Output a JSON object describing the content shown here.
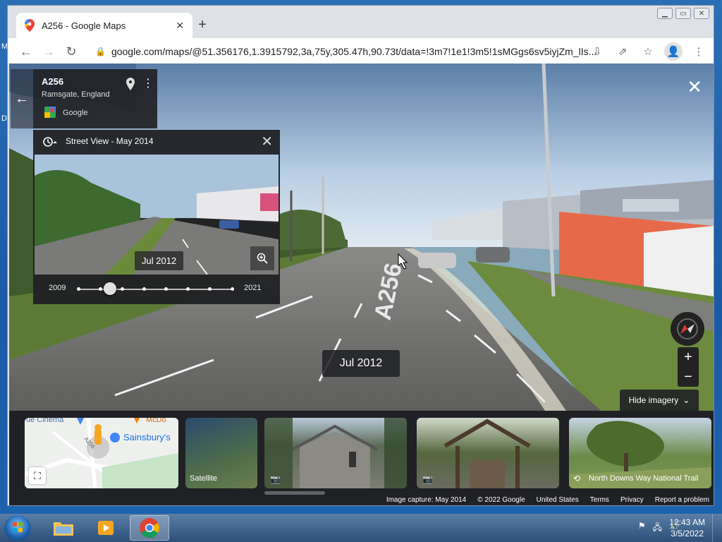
{
  "desktop": {
    "left_letters": [
      "M",
      "D"
    ]
  },
  "browser": {
    "tab_title": "A256 - Google Maps",
    "url": "google.com/maps/@51.356176,1.3915792,3a,75y,305.47h,90.73t/data=!3m7!1e1!3m5!1sMGgs6sv5iyjZm_lIs..."
  },
  "info_card": {
    "road": "A256",
    "place": "Ramsgate, England",
    "source": "Google"
  },
  "time_panel": {
    "header": "Street View - May 2014",
    "thumb_date": "Jul 2012",
    "start_year": "2009",
    "end_year": "2021",
    "selected_index": 1,
    "stops": 8
  },
  "current_date": "Jul 2012",
  "road_marking": "A256",
  "hide_imagery": "Hide imagery",
  "strip": {
    "map_labels": [
      "ue Cinema",
      "McDo",
      "Sainsbury's",
      "A256"
    ],
    "cards": [
      {
        "label": "Satellite"
      },
      {
        "label": ""
      },
      {
        "label": ""
      },
      {
        "label": "North Downs Way National Trail"
      }
    ]
  },
  "footer": [
    "Image capture: May 2014",
    "© 2022 Google",
    "United States",
    "Terms",
    "Privacy",
    "Report a problem"
  ],
  "taskbar": {
    "time": "12:43 AM",
    "date": "3/5/2022"
  },
  "colors": {
    "maps_blue": "#4285f4",
    "chrome_bg": "#dee1e6",
    "panel": "#202124"
  }
}
